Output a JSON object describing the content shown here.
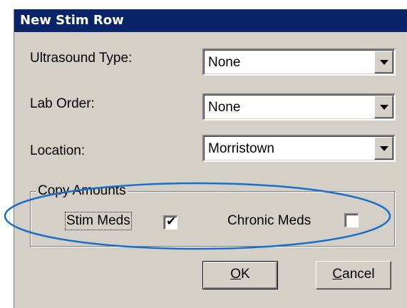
{
  "window": {
    "title": "New Stim Row"
  },
  "form": {
    "ultrasound": {
      "label": "Ultrasound Type:",
      "value": "None"
    },
    "lab_order": {
      "label": "Lab Order:",
      "value": "None"
    },
    "location": {
      "label": "Location:",
      "value": "Morristown"
    }
  },
  "copy_amounts": {
    "legend": "Copy Amounts",
    "stim_meds": {
      "label": "Stim Meds",
      "checked": true,
      "mark": "✔"
    },
    "chronic_meds": {
      "label": "Chronic Meds",
      "checked": false
    }
  },
  "buttons": {
    "ok": {
      "accel": "O",
      "rest": "K"
    },
    "cancel": {
      "accel": "C",
      "rest": "ancel"
    }
  },
  "colors": {
    "title_bar": "#0a246a",
    "dialog_face": "#d4d0c8",
    "annotation_ellipse": "#1b6fc9"
  }
}
